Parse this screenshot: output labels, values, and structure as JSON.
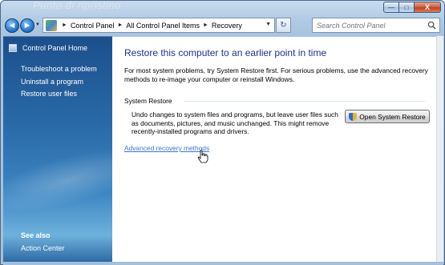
{
  "window": {
    "faded_title": "Punto di ripristino",
    "minimize": "—",
    "maximize": "□",
    "close": "X"
  },
  "nav": {
    "back": "◄",
    "forward": "►",
    "breadcrumbs": [
      "Control Panel",
      "All Control Panel Items",
      "Recovery"
    ],
    "search_placeholder": "Search Control Panel",
    "refresh": "↻"
  },
  "sidebar": {
    "home": "Control Panel Home",
    "links": [
      "Troubleshoot a problem",
      "Uninstall a program",
      "Restore user files"
    ],
    "see_also_heading": "See also",
    "see_also_item": "Action Center"
  },
  "main": {
    "title": "Restore this computer to an earlier point in time",
    "intro": "For most system problems, try System Restore first. For serious problems, use the advanced recovery methods to re-image your computer or reinstall Windows.",
    "section_heading": "System Restore",
    "section_desc": "Undo changes to system files and programs, but leave user files such as documents, pictures, and music unchanged. This might remove recently-installed programs and drivers.",
    "button_label": "Open System Restore",
    "advanced_link": "Advanced recovery methods"
  },
  "icons": {
    "control_panel": "control-panel-icon",
    "search": "search-icon",
    "shield": "shield-icon",
    "cursor": "hand-cursor-icon"
  },
  "colors": {
    "title_blue": "#1e3287",
    "link_blue": "#3c77c9",
    "sidebar_top": "#1c4f8c"
  }
}
